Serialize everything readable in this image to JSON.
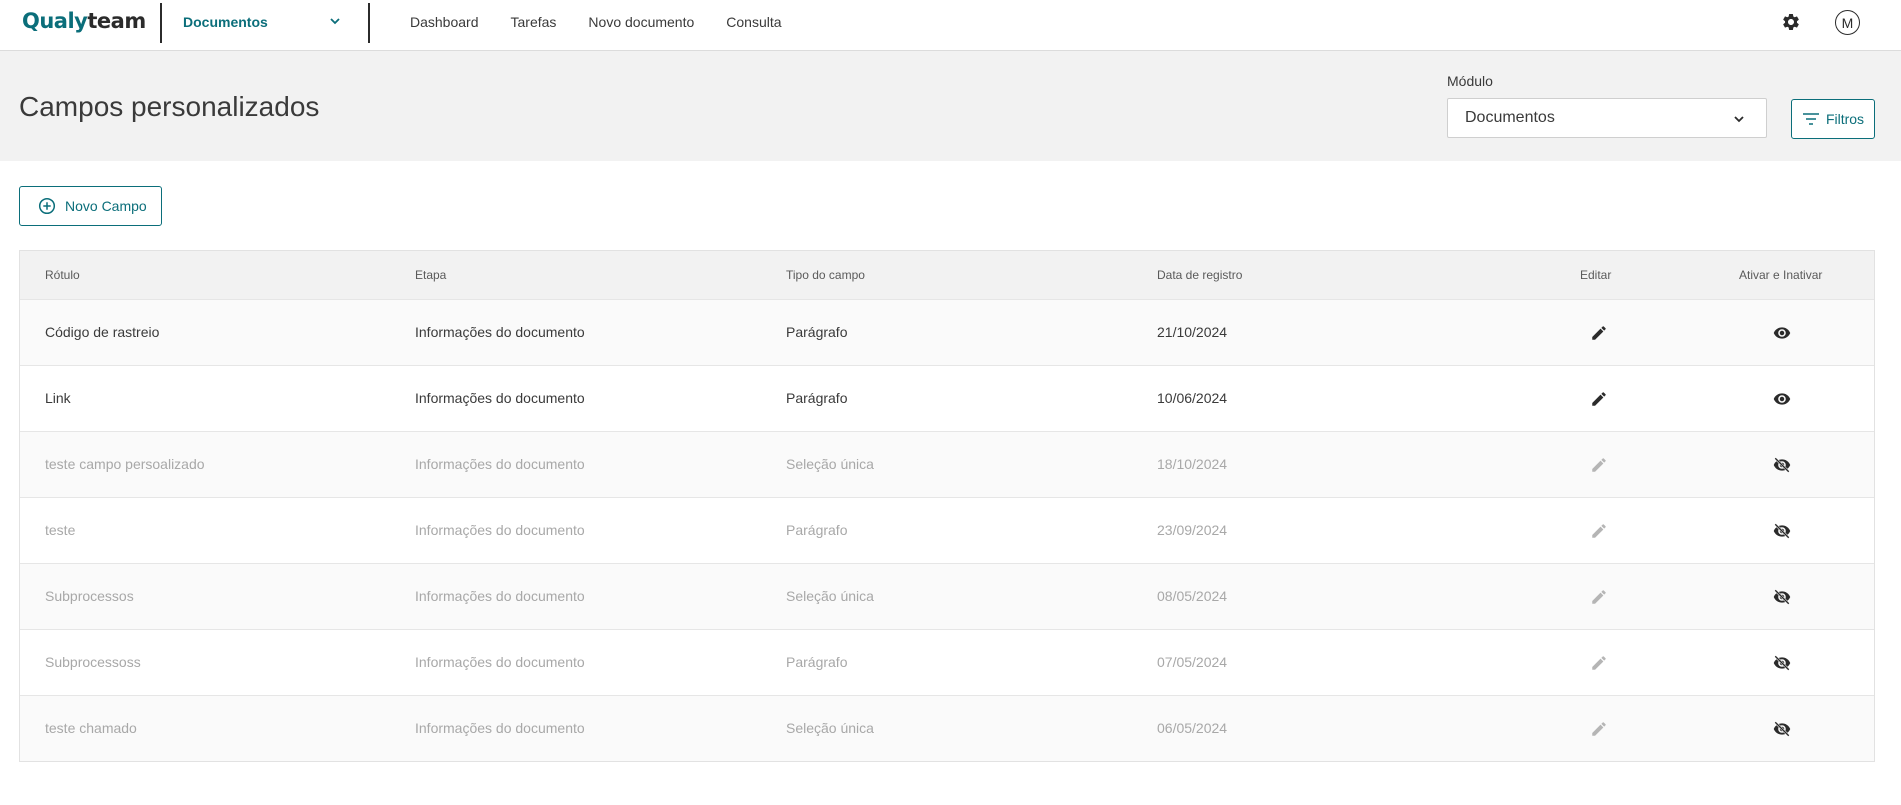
{
  "brand": {
    "part1": "Qualy",
    "part2": "team"
  },
  "topbar": {
    "module_selected": "Documentos",
    "nav": [
      "Dashboard",
      "Tarefas",
      "Novo documento",
      "Consulta"
    ],
    "avatar_initial": "M"
  },
  "header": {
    "title": "Campos personalizados",
    "modulo_label": "Módulo",
    "modulo_value": "Documentos",
    "filtros_label": "Filtros"
  },
  "actions": {
    "novo_campo_label": "Novo Campo"
  },
  "table": {
    "columns": [
      "Rótulo",
      "Etapa",
      "Tipo do campo",
      "Data de registro",
      "Editar",
      "Ativar e Inativar"
    ],
    "rows": [
      {
        "rotulo": "Código de rastreio",
        "etapa": "Informações do documento",
        "tipo": "Parágrafo",
        "data": "21/10/2024",
        "active": true
      },
      {
        "rotulo": "Link",
        "etapa": "Informações do documento",
        "tipo": "Parágrafo",
        "data": "10/06/2024",
        "active": true
      },
      {
        "rotulo": "teste campo persoalizado",
        "etapa": "Informações do documento",
        "tipo": "Seleção única",
        "data": "18/10/2024",
        "active": false
      },
      {
        "rotulo": "teste",
        "etapa": "Informações do documento",
        "tipo": "Parágrafo",
        "data": "23/09/2024",
        "active": false
      },
      {
        "rotulo": "Subprocessos",
        "etapa": "Informações do documento",
        "tipo": "Seleção única",
        "data": "08/05/2024",
        "active": false
      },
      {
        "rotulo": "Subprocessoss",
        "etapa": "Informações do documento",
        "tipo": "Parágrafo",
        "data": "07/05/2024",
        "active": false
      },
      {
        "rotulo": "teste chamado",
        "etapa": "Informações do documento",
        "tipo": "Seleção única",
        "data": "06/05/2024",
        "active": false
      }
    ]
  },
  "colors": {
    "accent": "#0b6e7a",
    "header_bg": "#f2f2f2",
    "inactive_text": "#a8a8a8"
  },
  "icons": [
    "chevron-down-icon",
    "gear-icon",
    "filter-icon",
    "add-circle-icon",
    "pencil-icon",
    "eye-icon",
    "eye-off-icon"
  ]
}
